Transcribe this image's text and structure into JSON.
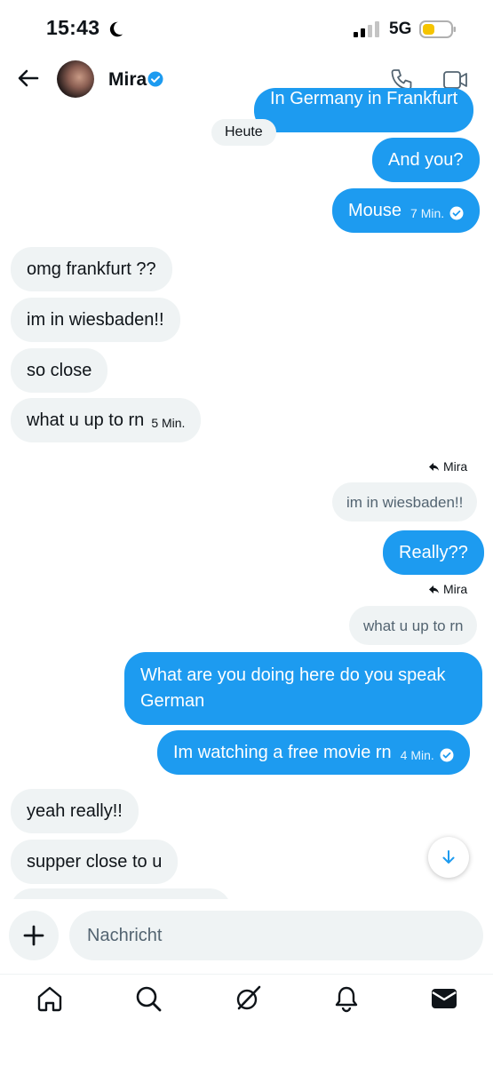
{
  "status_bar": {
    "time": "15:43",
    "network": "5G"
  },
  "header": {
    "contact_name": "Mira"
  },
  "date_separator": "Heute",
  "messages": {
    "m0": {
      "text": "In Germany in Frankfurt"
    },
    "m1": {
      "text": "And you?"
    },
    "m2": {
      "text": "Mouse",
      "time": "7 Min."
    },
    "m3": {
      "text": "omg frankfurt ??"
    },
    "m4": {
      "text": "im in wiesbaden!!"
    },
    "m5": {
      "text": "so close"
    },
    "m6": {
      "text": "what u up to rn",
      "time": "5 Min."
    },
    "r1": {
      "reply_to": "Mira",
      "quoted": "im in wiesbaden!!"
    },
    "m7": {
      "text": "Really??"
    },
    "r2": {
      "reply_to": "Mira",
      "quoted": "what u up to rn"
    },
    "m8": {
      "text": "What are you doing here do you speak German"
    },
    "m9": {
      "text": "Im watching a free movie rn",
      "time": "4 Min."
    },
    "m10": {
      "text": "yeah really!!"
    },
    "m11": {
      "text": "supper close to u"
    }
  },
  "composer": {
    "placeholder": "Nachricht"
  },
  "icons": {
    "status": [
      "moon-icon",
      "signal-icon",
      "battery-icon"
    ],
    "header": [
      "back-arrow-icon",
      "verified-badge-icon",
      "phone-icon",
      "video-call-icon"
    ],
    "nav": [
      "home-icon",
      "search-icon",
      "grok-icon",
      "notifications-icon",
      "messages-icon"
    ]
  },
  "colors": {
    "accent": "#1d9bf0",
    "incoming_bubble": "#eff3f4",
    "battery": "#f5c400"
  }
}
